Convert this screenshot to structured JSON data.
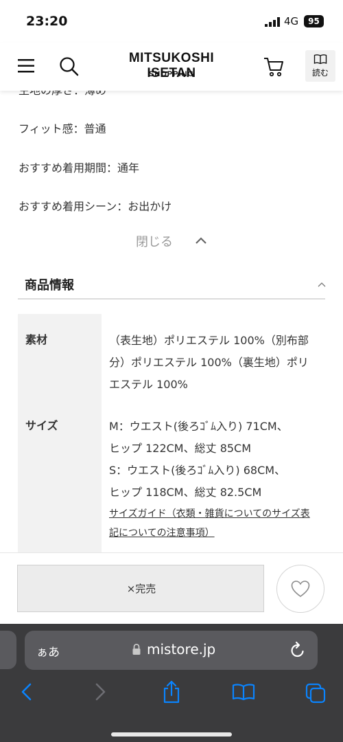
{
  "status": {
    "time": "23:20",
    "network": "4G",
    "battery": "95"
  },
  "header": {
    "brand_title": "MITSUKOSHI ISETAN",
    "brand_subtitle": "SHOPPING",
    "read_label": "読む",
    "icons": [
      "menu-icon",
      "search-icon",
      "cart-icon",
      "book-icon"
    ]
  },
  "details": {
    "cut_off_line": "生地の厚さ：薄め",
    "fit": "フィット感：普通",
    "period": "おすすめ着用期間：通年",
    "scene": "おすすめ着用シーン：お出かけ",
    "close_label": "閉じる"
  },
  "product_info": {
    "title": "商品情報",
    "rows": [
      {
        "label": "素材",
        "value": "（表生地）ポリエステル 100%（別布部分）ポリエステル 100%（裏生地）ポリエステル 100%"
      },
      {
        "label": "サイズ",
        "value_lines": [
          "M：ウエスト(後ろｺﾞﾑ入り) 71CM、",
          "ヒップ 122CM、総丈 85CM",
          "S：ウエスト(後ろｺﾞﾑ入り) 68CM、",
          "ヒップ 118CM、総丈 82.5CM"
        ],
        "link": "サイズガイド（衣類・雑貨についてのサイズ表記についての注意事項）"
      }
    ]
  },
  "buy_bar": {
    "soldout_label": "×完売"
  },
  "safari": {
    "text_size": "ぁあ",
    "url": "mistore.jp"
  },
  "colors": {
    "safari_bg": "#3b3b3d",
    "safari_field": "#5a5a5e",
    "safari_accent": "#0a84ff"
  }
}
